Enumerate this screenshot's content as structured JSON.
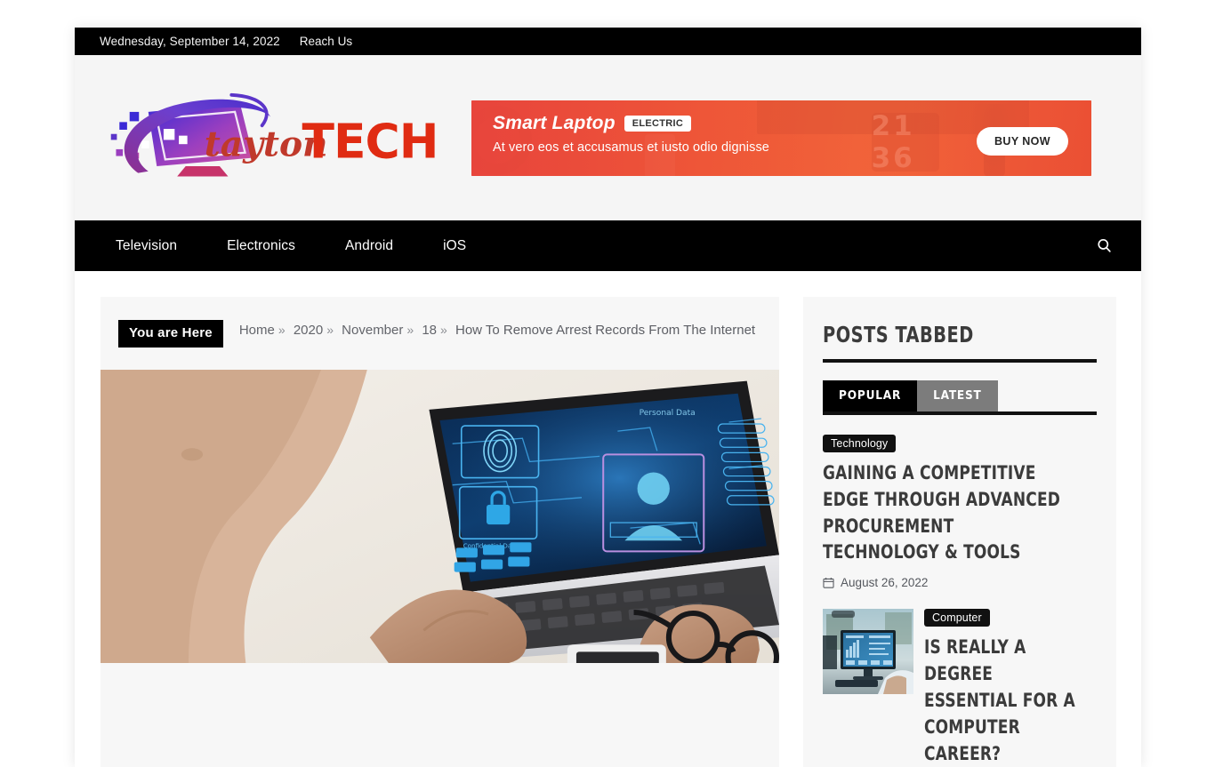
{
  "topbar": {
    "date": "Wednesday, September 14, 2022",
    "reach_us": "Reach Us"
  },
  "branding": {
    "logo_text_script": "tayton",
    "logo_text_bold": "TECH",
    "logo_colors": {
      "script": "#c0392b",
      "bold": "#e02b12",
      "monitor_start": "#3b2ad6",
      "monitor_end": "#d0529d"
    }
  },
  "banner": {
    "title": "Smart Laptop",
    "badge": "ELECTRIC",
    "subtitle": "At vero eos et accusamus et iusto odio dignisse",
    "cta": "BUY NOW",
    "clock": "21 36",
    "accent": "#ee5634"
  },
  "nav": {
    "items": [
      {
        "label": "Television"
      },
      {
        "label": "Electronics"
      },
      {
        "label": "Android"
      },
      {
        "label": "iOS"
      }
    ],
    "search_icon": "search-icon"
  },
  "breadcrumb": {
    "badge": "You are Here",
    "separator": "»",
    "items": [
      "Home",
      "2020",
      "November",
      "18"
    ],
    "current": "How To Remove Arrest Records From The Internet"
  },
  "featured": {
    "alt": "Person typing on a laptop displaying a blue biometric personal-data security interface",
    "screen_label": "Personal Data",
    "screen_sub_label": "Confidential Data"
  },
  "sidebar": {
    "widget_title": "Posts Tabbed",
    "tabs": [
      {
        "label": "Popular",
        "active": true
      },
      {
        "label": "Latest",
        "active": false
      }
    ],
    "posts": [
      {
        "category": "Technology",
        "title": "Gaining A Competitive Edge Through Advanced Procurement Technology & Tools",
        "date": "August 26, 2022",
        "has_thumb": false
      },
      {
        "category": "Computer",
        "title": "Is Really A Degree Essential For A Computer Career?",
        "date": "",
        "has_thumb": true,
        "thumb_alt": "Desktop monitor showing a blue analytics dashboard in an office"
      }
    ]
  }
}
